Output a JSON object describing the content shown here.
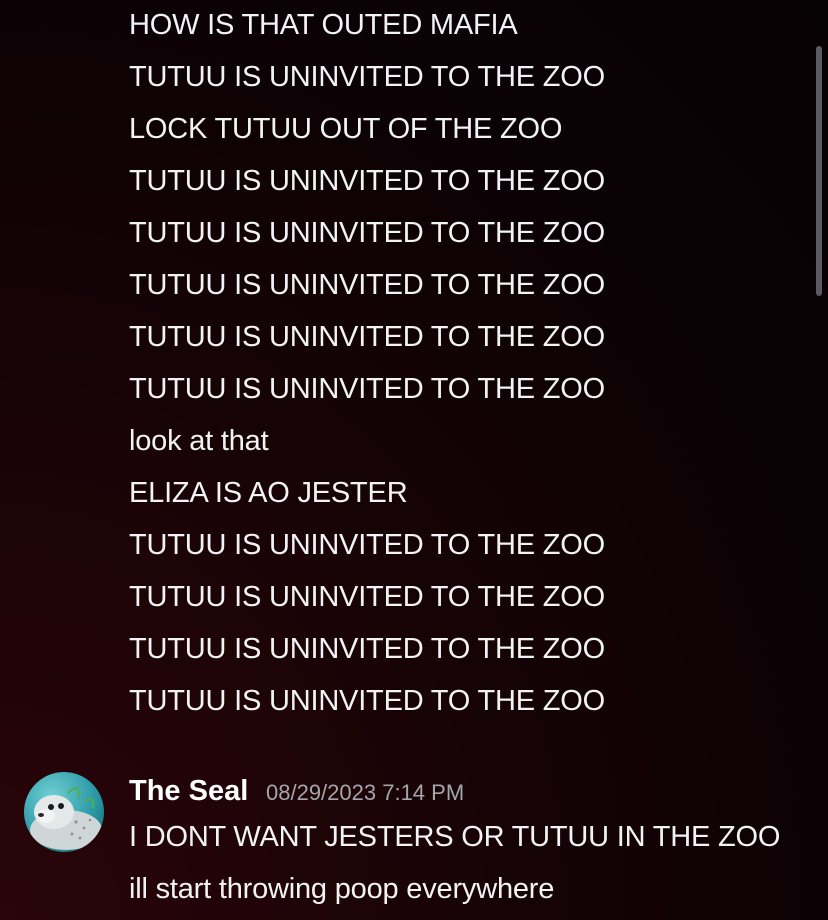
{
  "messages": {
    "continued_lines": [
      "HOW IS THAT OUTED MAFIA",
      "TUTUU IS UNINVITED TO THE ZOO",
      "LOCK TUTUU OUT OF THE ZOO",
      "TUTUU IS UNINVITED TO THE ZOO",
      "TUTUU IS UNINVITED TO THE ZOO",
      "TUTUU IS UNINVITED TO THE ZOO",
      "TUTUU IS UNINVITED TO THE ZOO",
      "TUTUU IS UNINVITED TO THE ZOO",
      "look at that",
      "ELIZA IS AO JESTER",
      "TUTUU IS UNINVITED TO THE ZOO",
      "TUTUU IS UNINVITED TO THE ZOO",
      "TUTUU IS UNINVITED TO THE ZOO",
      "TUTUU IS UNINVITED TO THE ZOO"
    ],
    "group": {
      "author": "The Seal",
      "timestamp": "08/29/2023 7:14 PM",
      "avatar_icon": "seal-avatar-icon",
      "lines": [
        "I DONT WANT JESTERS OR TUTUU IN THE ZOO",
        "ill start throwing poop everywhere"
      ]
    }
  },
  "colors": {
    "text": "#f2f3f5",
    "timestamp": "#a3a6ad",
    "background_accent": "#2a0509"
  }
}
